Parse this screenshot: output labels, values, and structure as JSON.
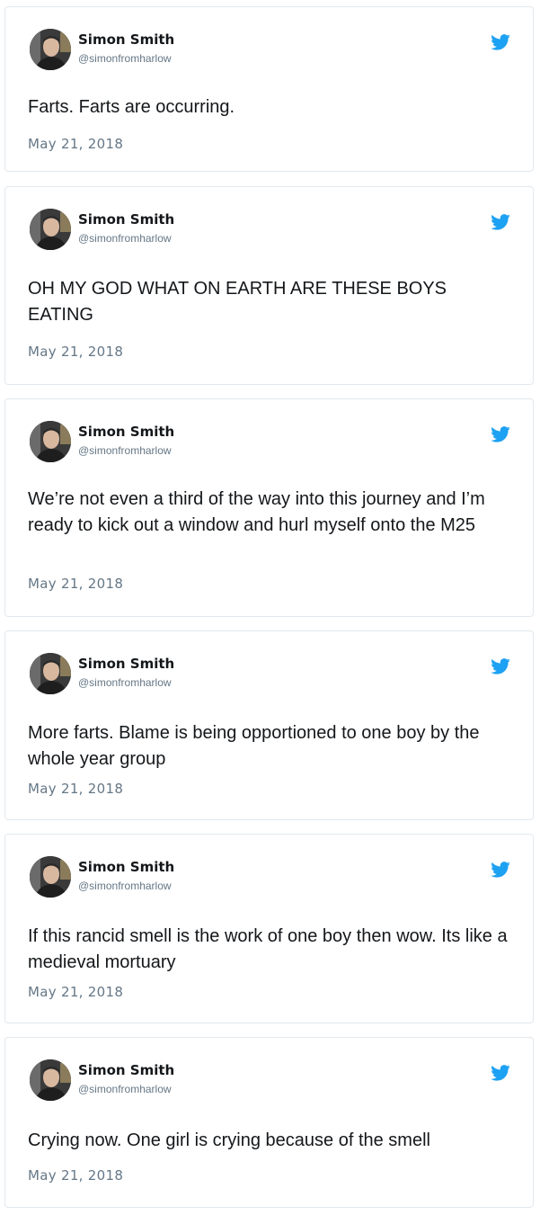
{
  "tweets": [
    {
      "name": "Simon Smith",
      "handle": "@simonfromharlow",
      "text": "Farts. Farts are occurring.",
      "date": "May 21, 2018"
    },
    {
      "name": "Simon Smith",
      "handle": "@simonfromharlow",
      "text": "OH MY GOD WHAT ON EARTH ARE THESE BOYS EATING",
      "date": "May 21, 2018"
    },
    {
      "name": "Simon Smith",
      "handle": "@simonfromharlow",
      "text": "We’re not even a third of the way into this journey and I’m ready to kick out a window and hurl myself onto the M25",
      "date": "May 21, 2018"
    },
    {
      "name": "Simon Smith",
      "handle": "@simonfromharlow",
      "text": "More farts. Blame is being opportioned to one boy by the whole year group",
      "date": "May 21, 2018"
    },
    {
      "name": "Simon Smith",
      "handle": "@simonfromharlow",
      "text": "If this rancid smell is the work of one boy then wow. Its like a medieval mortuary",
      "date": "May 21, 2018"
    },
    {
      "name": "Simon Smith",
      "handle": "@simonfromharlow",
      "text": "Crying now. One girl is crying because of the smell",
      "date": "May 21, 2018"
    }
  ],
  "colors": {
    "twitter_blue": "#1da1f2",
    "text": "#14171a",
    "muted": "#657786",
    "border": "#e1e8ed"
  },
  "icons": {
    "avatar": "profile-photo",
    "brand": "twitter-bird-icon"
  }
}
